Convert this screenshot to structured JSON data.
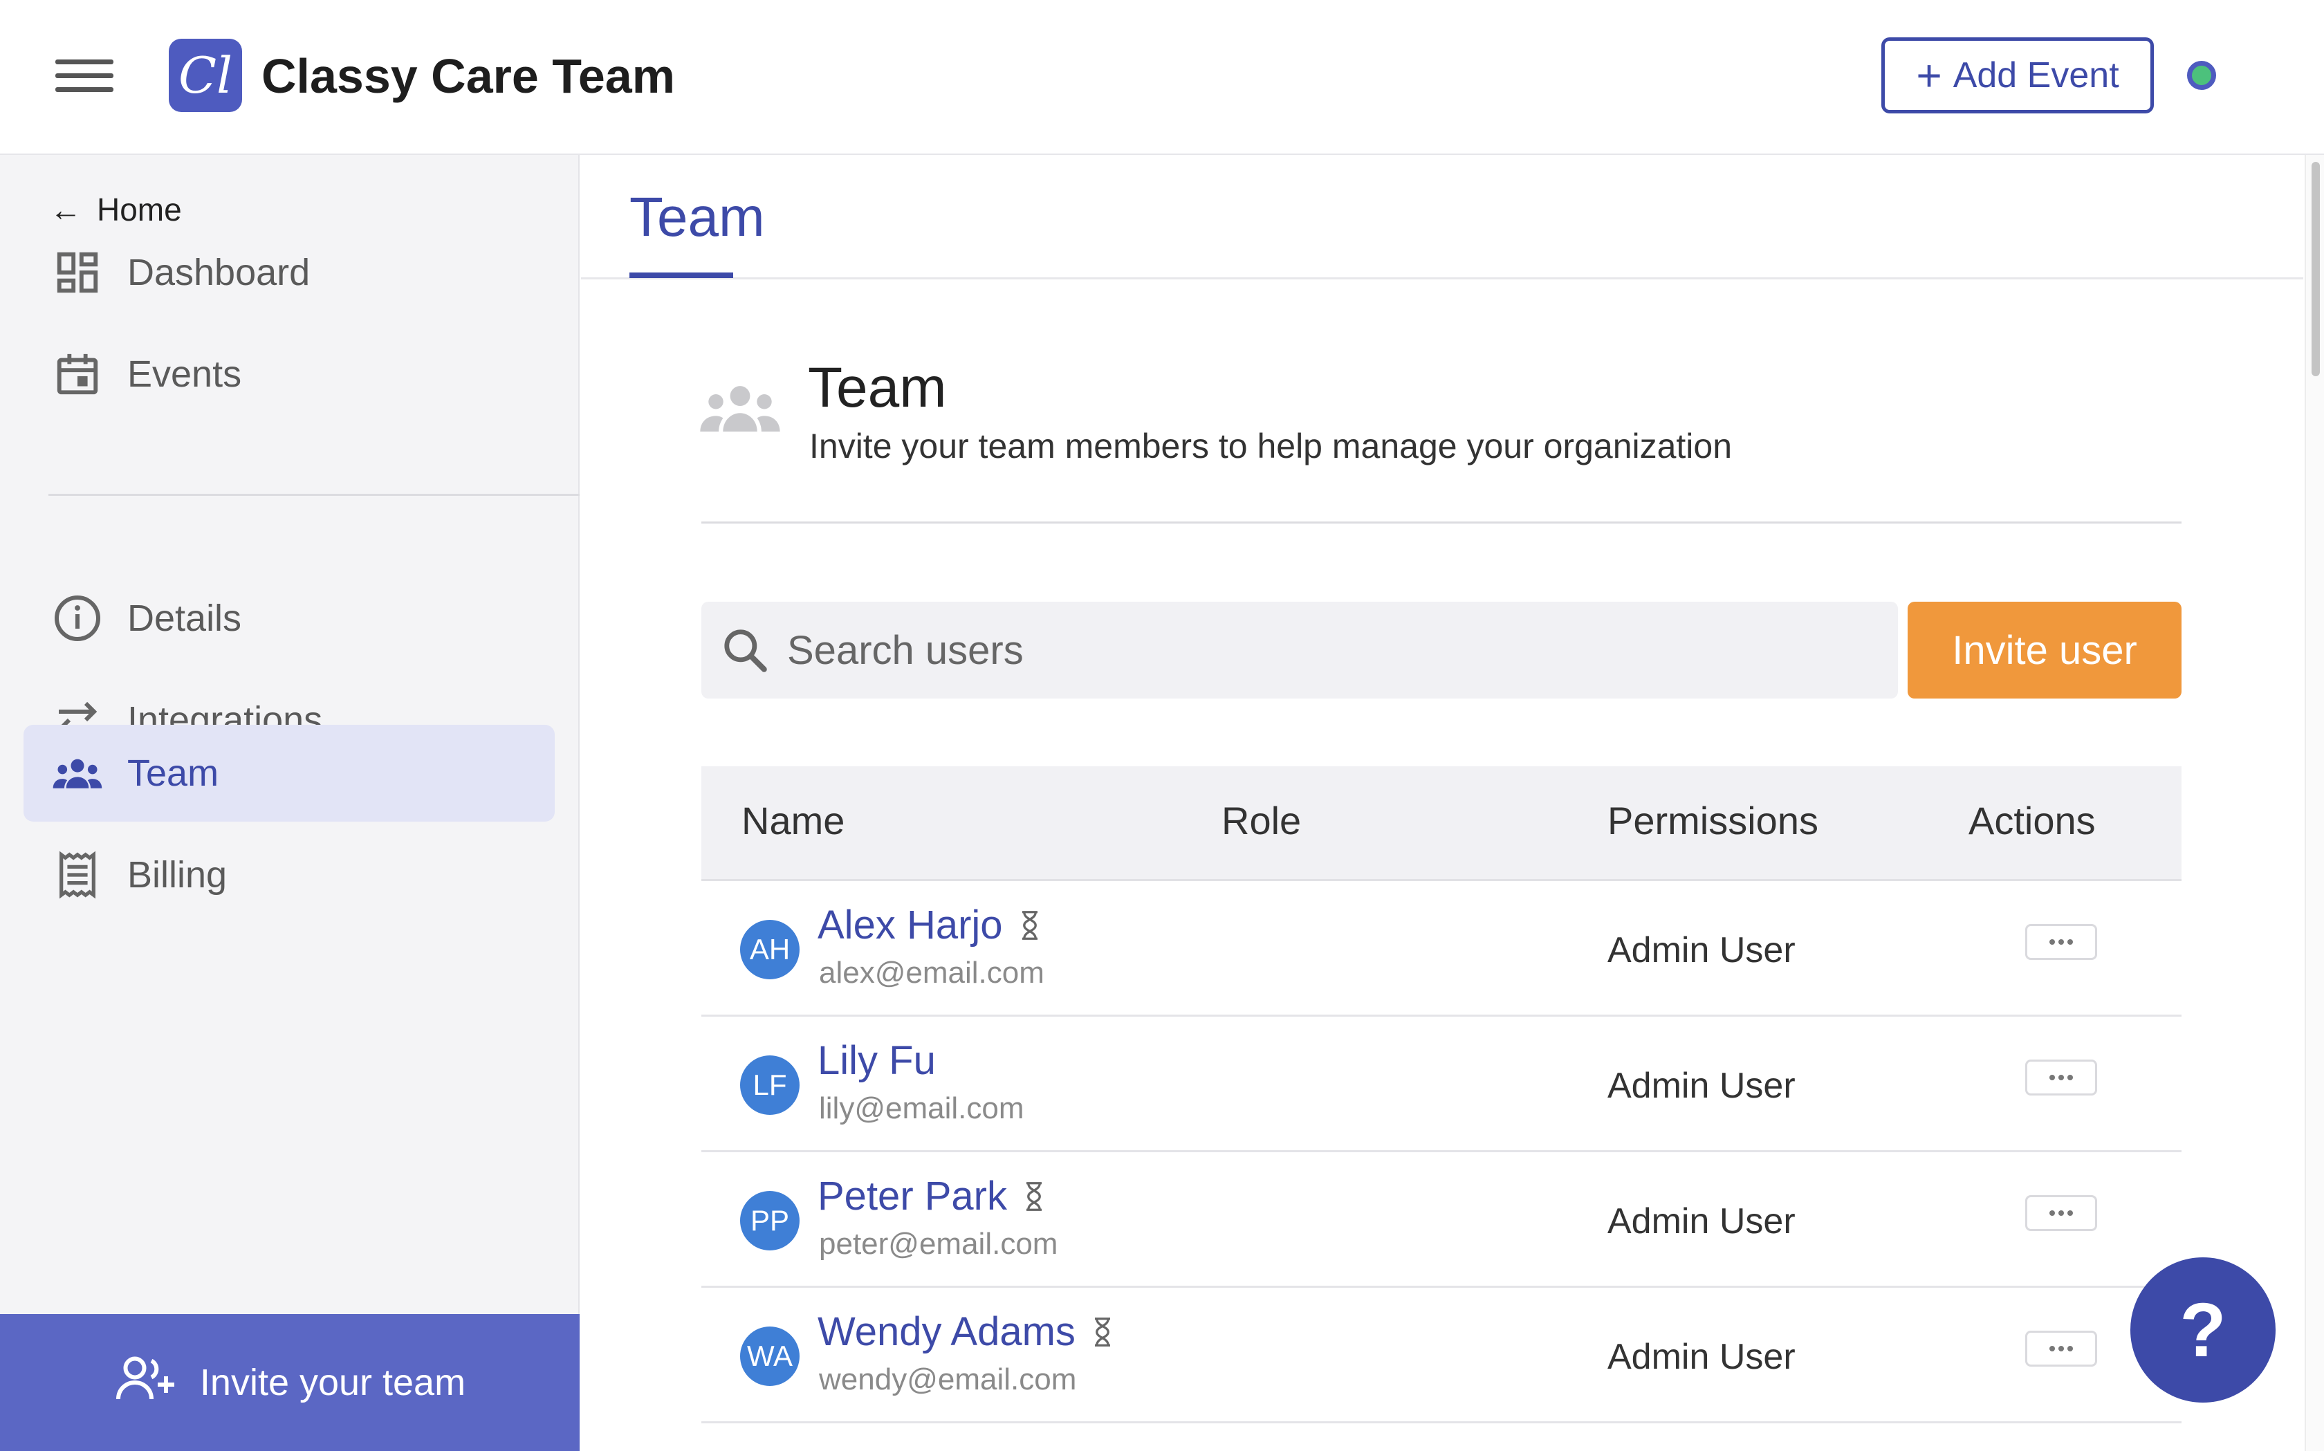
{
  "header": {
    "logo_text": "Cl",
    "org_name": "Classy Care Team",
    "add_event_label": "Add Event",
    "add_event_icon": "plus-icon",
    "status_color": "#4cc17c"
  },
  "sidebar": {
    "home_label": "Home",
    "items": [
      {
        "label": "Dashboard",
        "icon": "dashboard-icon"
      },
      {
        "label": "Events",
        "icon": "calendar-icon"
      },
      {
        "label": "Details",
        "icon": "info-icon"
      },
      {
        "label": "Integrations",
        "icon": "swap-arrows-icon"
      },
      {
        "label": "Team",
        "icon": "team-icon",
        "active": true
      },
      {
        "label": "Billing",
        "icon": "receipt-icon"
      }
    ],
    "invite_team_label": "Invite your team"
  },
  "main": {
    "tab_label": "Team",
    "section_title": "Team",
    "section_subtitle": "Invite your team members to help manage your organization",
    "search_placeholder": "Search users",
    "invite_user_label": "Invite user",
    "table": {
      "headers": [
        "Name",
        "Role",
        "Permissions",
        "Actions"
      ],
      "rows": [
        {
          "initials": "AH",
          "name": "Alex Harjo",
          "email": "alex@email.com",
          "role": "",
          "permissions": "Admin User",
          "pending": true
        },
        {
          "initials": "LF",
          "name": "Lily Fu",
          "email": "lily@email.com",
          "role": "",
          "permissions": "Admin User",
          "pending": false
        },
        {
          "initials": "PP",
          "name": "Peter Park",
          "email": "peter@email.com",
          "role": "",
          "permissions": "Admin User",
          "pending": true
        },
        {
          "initials": "WA",
          "name": "Wendy Adams",
          "email": "wendy@email.com",
          "role": "",
          "permissions": "Admin User",
          "pending": true
        }
      ]
    }
  },
  "help_label": "?",
  "colors": {
    "brand": "#3d4aa8",
    "accent": "#f0983c",
    "avatar": "#3f7fd6",
    "sidebar_cta": "#5b67c4"
  }
}
